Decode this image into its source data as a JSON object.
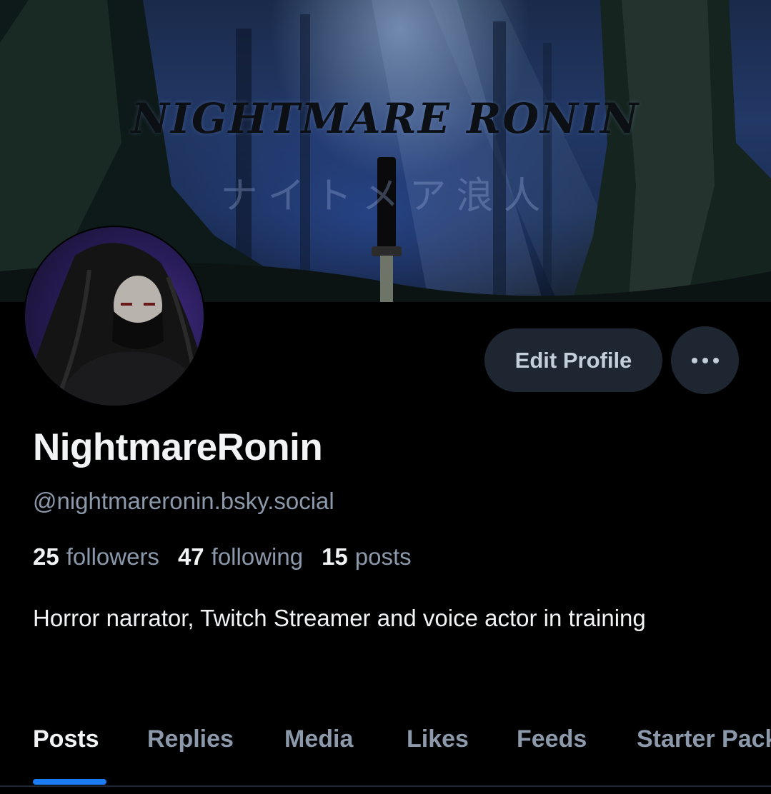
{
  "banner": {
    "title": "NIGHTMARE RONIN",
    "subtitle": "ナイトメア浪人"
  },
  "profile": {
    "display_name": "NightmareRonin",
    "handle": "@nightmareronin.bsky.social",
    "bio": "Horror narrator, Twitch Streamer and voice actor in training",
    "stats": {
      "followers_count": "25",
      "followers_label": "followers",
      "following_count": "47",
      "following_label": "following",
      "posts_count": "15",
      "posts_label": "posts"
    }
  },
  "actions": {
    "edit_profile_label": "Edit Profile",
    "more_icon": "ellipsis-icon"
  },
  "tabs": [
    {
      "label": "Posts",
      "active": true
    },
    {
      "label": "Replies",
      "active": false
    },
    {
      "label": "Media",
      "active": false
    },
    {
      "label": "Likes",
      "active": false
    },
    {
      "label": "Feeds",
      "active": false
    },
    {
      "label": "Starter Packs",
      "active": false
    }
  ],
  "colors": {
    "background": "#000000",
    "button_bg": "#1e2731",
    "muted_text": "#8b99ab",
    "primary_text": "#f1f3f5",
    "accent": "#1e7cf2"
  }
}
